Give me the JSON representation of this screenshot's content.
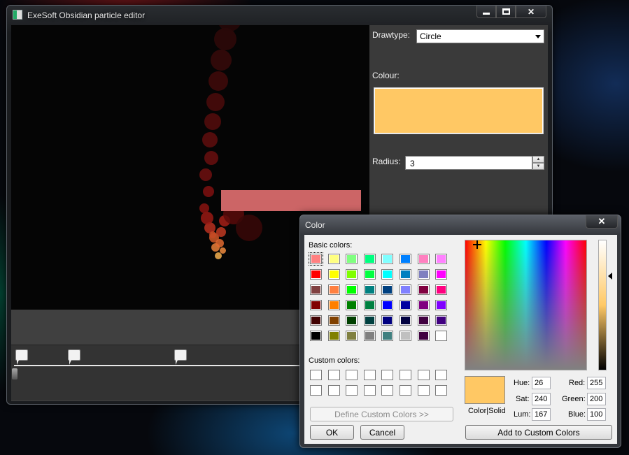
{
  "main_window": {
    "title": "ExeSoft Obsidian particle editor",
    "drawtype_label": "Drawtype:",
    "drawtype_value": "Circle",
    "colour_label": "Colour:",
    "colour_value": "#ffc864",
    "radius_label": "Radius:",
    "radius_value": "3",
    "timeline_markers": 3
  },
  "color_dialog": {
    "title": "Color",
    "close_label": "✕",
    "basic_colors_label": "Basic colors:",
    "basic_colors": [
      "#ff8080",
      "#ffff80",
      "#80ff80",
      "#00ff80",
      "#80ffff",
      "#0080ff",
      "#ff80c0",
      "#ff80ff",
      "#ff0000",
      "#ffff00",
      "#80ff00",
      "#00ff40",
      "#00ffff",
      "#0080c0",
      "#8080c0",
      "#ff00ff",
      "#804040",
      "#ff8040",
      "#00ff00",
      "#008080",
      "#004080",
      "#8080ff",
      "#800040",
      "#ff0080",
      "#800000",
      "#ff8000",
      "#008000",
      "#008040",
      "#0000ff",
      "#0000a0",
      "#800080",
      "#8000ff",
      "#400000",
      "#804000",
      "#004000",
      "#004040",
      "#000080",
      "#000040",
      "#400040",
      "#400080",
      "#000000",
      "#808000",
      "#808040",
      "#808080",
      "#408080",
      "#c0c0c0",
      "#400040",
      "#ffffff"
    ],
    "custom_colors_label": "Custom colors:",
    "define_custom_label": "Define Custom Colors >>",
    "ok_label": "OK",
    "cancel_label": "Cancel",
    "color_solid_label": "Color|Solid",
    "add_custom_label": "Add to Custom Colors",
    "hue_label": "Hue:",
    "hue": "26",
    "sat_label": "Sat:",
    "sat": "240",
    "lum_label": "Lum:",
    "lum": "167",
    "red_label": "Red:",
    "red": "255",
    "green_label": "Green:",
    "green": "200",
    "blue_label": "Blue:",
    "blue": "100",
    "selected_color": "#ffc864"
  }
}
